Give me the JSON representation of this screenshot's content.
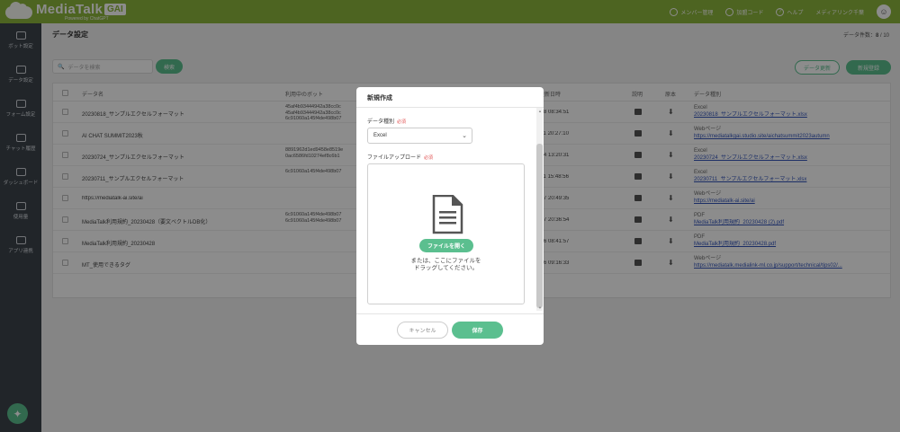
{
  "app": {
    "logo_text": "MediaTalk",
    "logo_badge": "GAI",
    "logo_sub": "Powered by ChatGPT"
  },
  "topnav": {
    "members": "メンバー管理",
    "invite": "加盟コード",
    "help": "ヘルプ",
    "company": "メディアリンク千葉"
  },
  "sidebar": {
    "items": [
      {
        "label": "ボット設定"
      },
      {
        "label": "データ設定"
      },
      {
        "label": "フォーム設定"
      },
      {
        "label": "チャット履歴"
      },
      {
        "label": "ダッシュボード"
      },
      {
        "label": "使用量"
      },
      {
        "label": "アプリ連携"
      }
    ]
  },
  "page": {
    "title": "データ設定",
    "count_label": "データ件数：",
    "count_value": "8",
    "count_total": " / 10",
    "search_placeholder": "データを検索",
    "search_button": "検索",
    "update_button": "データ更新",
    "new_button": "新規登録"
  },
  "table": {
    "headers": {
      "name": "データ名",
      "bot": "利用中のボット",
      "date": "更新日時",
      "desc": "説明",
      "dl": "原本",
      "type": "データ種別"
    },
    "rows": [
      {
        "name": "20230818_サンプルエクセルフォーマット",
        "bot": [
          "45af4b93444942a38cc0c",
          "45af4b93444942a38cc0c",
          "6c91060a145f4de498b07"
        ],
        "date": "/18 08:34:51",
        "type": "Excel",
        "link": "20230818_サンプルエクセルフォーマット.xlsx"
      },
      {
        "name": "AI CHAT SUMMIT2023秋",
        "bot": [
          "",
          "",
          ""
        ],
        "date": "/11 20:27:10",
        "type": "Webページ",
        "link": "https://mediatalkgai.studio.site/aichatsummit2023autumn"
      },
      {
        "name": "20230724_サンプルエクセルフォーマット",
        "bot": [
          "8891962d1ed9458e8519e",
          "0ac6586fd10274ef8c6b1",
          ""
        ],
        "date": "/24 13:20:31",
        "type": "Excel",
        "link": "20230724_サンプルエクセルフォーマット.xlsx"
      },
      {
        "name": "20230711_サンプルエクセルフォーマット",
        "bot": [
          "6c91060a145f4de498b07",
          "",
          ""
        ],
        "date": "/11 15:48:56",
        "type": "Excel",
        "link": "20230711_サンプルエクセルフォーマット.xlsx"
      },
      {
        "name": "https://mediatalk-ai.site/ai",
        "bot": [
          "",
          "",
          ""
        ],
        "date": "/07 20:49:35",
        "type": "Webページ",
        "link": "https://mediatalk-ai.site/ai"
      },
      {
        "name": "MediaTalk利用規約_20230428（要文ベクトルDB化）",
        "bot": [
          "6c91060a145f4de498b07",
          "6c91060a145f4de498b07",
          ""
        ],
        "date": "/07 20:36:54",
        "type": "PDF",
        "link": "MediaTalk利用規約_20230428 (2).pdf"
      },
      {
        "name": "MediaTalk利用規約_20230428",
        "bot": [
          "",
          "",
          ""
        ],
        "date": "/26 08:41:57",
        "type": "PDF",
        "link": "MediaTalk利用規約_20230428.pdf"
      },
      {
        "name": "MT_使用できるタグ",
        "bot": [
          "",
          "",
          ""
        ],
        "date": "/06 09:16:33",
        "type": "Webページ",
        "link": "https://mediatalk.medialink-ml.co.jp/support/technical/tips02/..."
      }
    ]
  },
  "modal": {
    "title": "新規作成",
    "type_label": "データ種別",
    "required": "必須",
    "type_value": "Excel",
    "upload_label": "ファイルアップロード",
    "open_file": "ファイルを開く",
    "drop_line1": "または、ここにファイルを",
    "drop_line2": "ドラッグしてください。",
    "cancel": "キャンセル",
    "save": "保存"
  }
}
